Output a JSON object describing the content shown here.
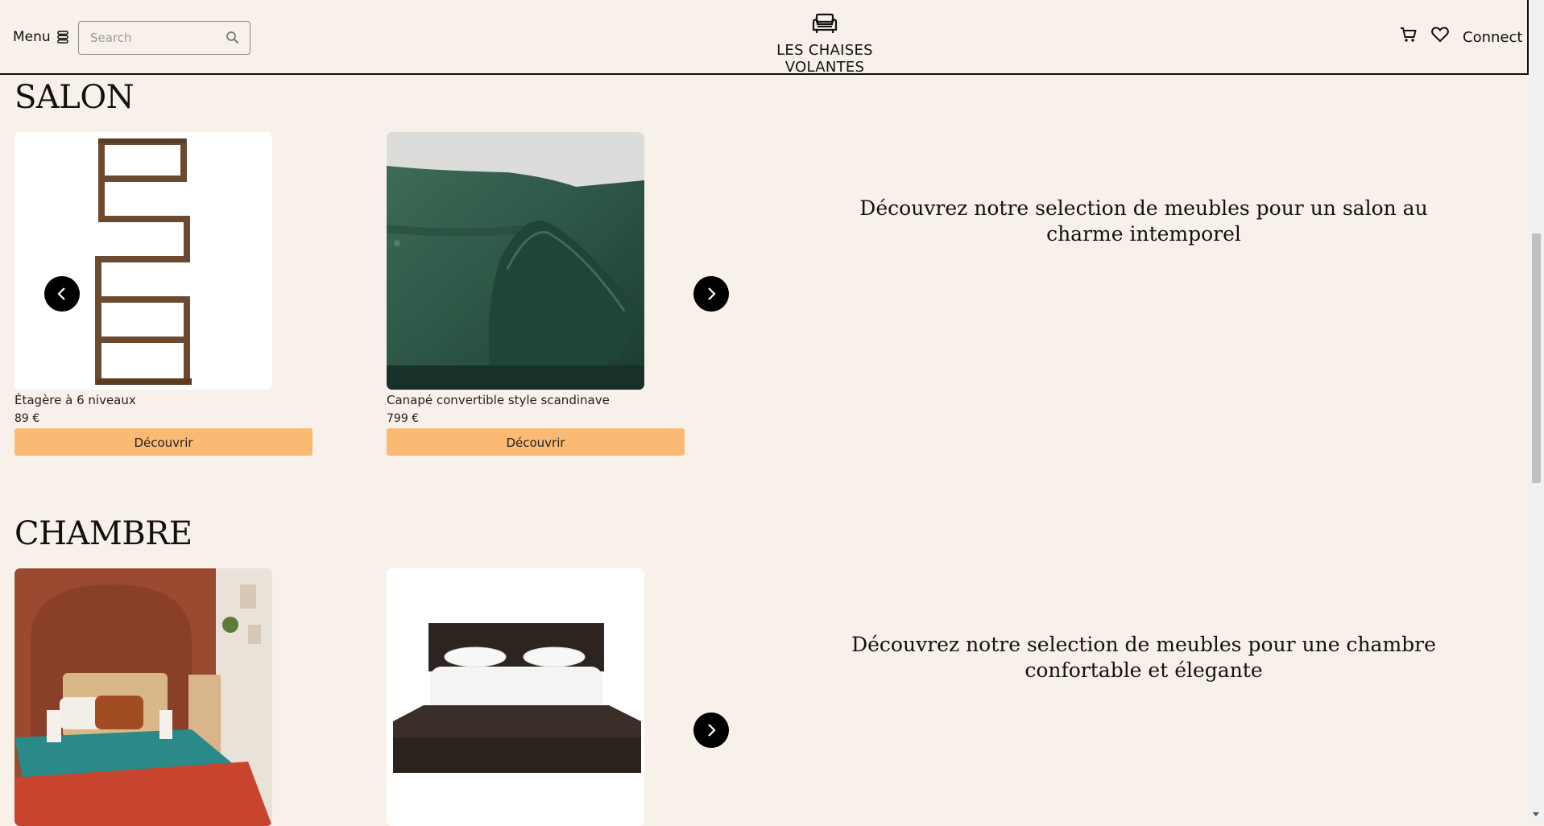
{
  "header": {
    "menu_label": "Menu",
    "search_placeholder": "Search",
    "brand_name": "LES CHAISES VOLANTES",
    "connect_label": "Connect"
  },
  "sections": [
    {
      "title": "SALON",
      "tagline": "Découvrez notre selection de meubles pour un salon au charme intemporel",
      "products": [
        {
          "name": "Étagère à 6 niveaux",
          "price": "89 €",
          "button": "Découvrir"
        },
        {
          "name": "Canapé convertible style scandinave",
          "price": "799 €",
          "button": "Découvrir"
        }
      ]
    },
    {
      "title": "CHAMBRE",
      "tagline": "Découvrez notre selection de meubles pour une chambre confortable et élegante",
      "products": [
        {
          "name": "",
          "price": "",
          "button": ""
        },
        {
          "name": "",
          "price": "",
          "button": ""
        }
      ]
    }
  ],
  "colors": {
    "background": "#f8f1e9",
    "button": "#fbba73",
    "arrow": "#000000"
  },
  "icons": [
    "menu-icon",
    "search-icon",
    "armchair-logo-icon",
    "cart-icon",
    "heart-icon",
    "chevron-left-icon",
    "chevron-right-icon"
  ]
}
